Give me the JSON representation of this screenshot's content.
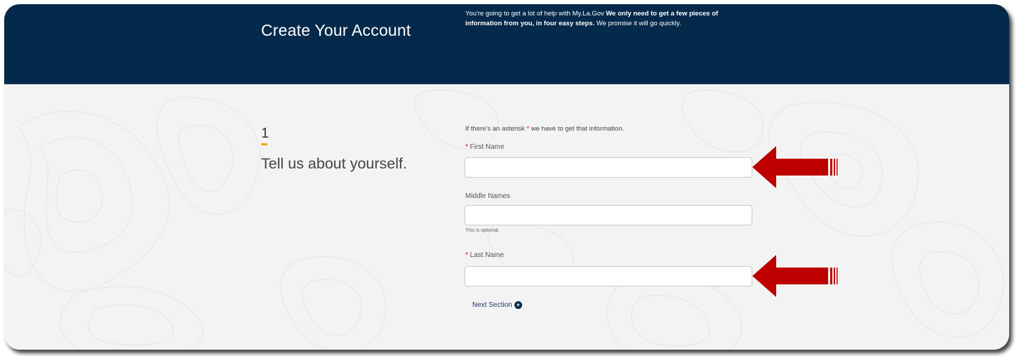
{
  "header": {
    "title": "Create Your Account",
    "intro_plain_1": "You're going to get a lot of help with My.La.Gov ",
    "intro_bold": "We only need to get a few pieces of information from you, in four easy steps.",
    "intro_plain_2": " We promise it will go quickly."
  },
  "step": {
    "number": "1",
    "title": "Tell us about yourself."
  },
  "form": {
    "note_before": "If there's an asterisk ",
    "note_asterisk": "*",
    "note_after": " we have to get that information.",
    "first_name": {
      "asterisk": "*",
      "label": " First Name",
      "value": ""
    },
    "middle_names": {
      "label": "Middle Names",
      "value": "",
      "help": "This is optional."
    },
    "last_name": {
      "asterisk": "*",
      "label": " Last Name",
      "value": ""
    },
    "next_label": "Next Section",
    "next_icon": "plus-circle-icon"
  },
  "colors": {
    "header_bg": "#05294b",
    "accent_underline": "#f2a900",
    "required_asterisk": "#cc0000",
    "annotation_arrow": "#bf0000"
  }
}
